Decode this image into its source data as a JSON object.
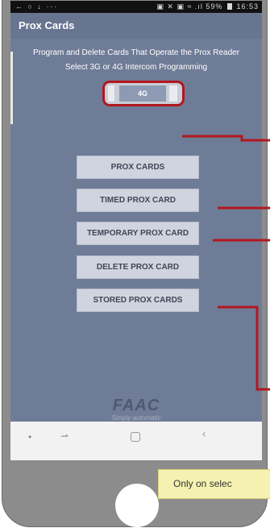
{
  "status_bar": {
    "left_icons": "← ○ ↓ ···",
    "right_icons": "▣ ✕ ▣ ≈ .ıl",
    "battery": "59%",
    "time": "16:53"
  },
  "header": {
    "title": "Prox Cards"
  },
  "content": {
    "description": "Program and Delete Cards That Operate the Prox Reader",
    "instruction": "Select 3G or 4G Intercom Programming",
    "selector_value": "4G"
  },
  "buttons": [
    {
      "label": "PROX CARDS"
    },
    {
      "label": "TIMED PROX CARD"
    },
    {
      "label": "TEMPORARY PROX CARD"
    },
    {
      "label": "DELETE PROX CARD"
    },
    {
      "label": "STORED PROX CARDS"
    }
  ],
  "branding": {
    "logo": "FAAC",
    "tagline": "Simply automatic"
  },
  "nav_bar": {
    "dot": "•",
    "recent": "⇀",
    "back": "‹"
  },
  "annotation": {
    "text": "Only on selec",
    "accent_color": "#b3171f"
  },
  "colors": {
    "app_background": "#6f7c97",
    "button_background": "#cfd4de",
    "callout_background": "#f5f2b1",
    "phone_body": "#8c8c8c"
  }
}
